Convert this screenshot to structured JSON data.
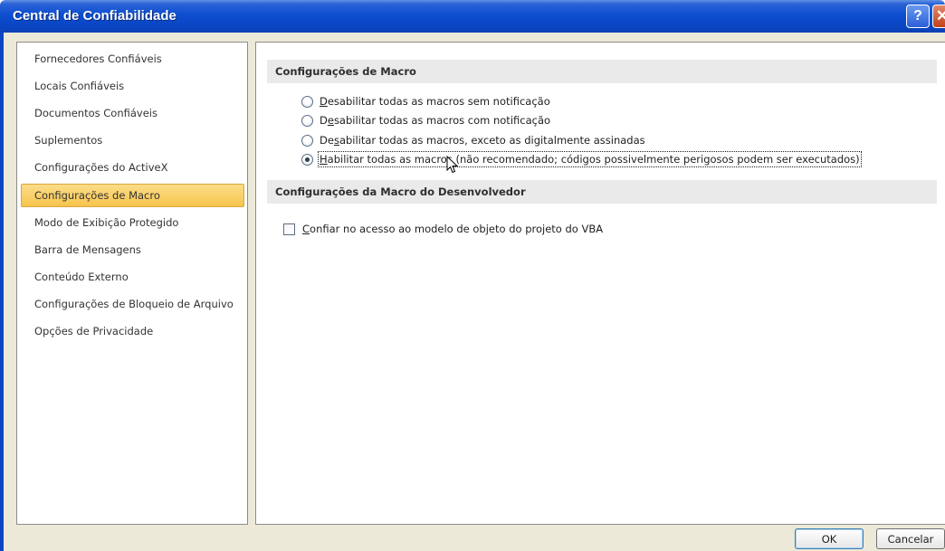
{
  "window": {
    "title": "Central de Confiabilidade",
    "help_icon": "help-icon",
    "help_glyph": "?",
    "close_icon": "close-icon",
    "close_glyph": "✕"
  },
  "sidebar": {
    "selected_index": 5,
    "selected_color": "#f7c54d",
    "items": [
      {
        "label": "Fornecedores Confiáveis"
      },
      {
        "label": "Locais Confiáveis"
      },
      {
        "label": "Documentos Confiáveis"
      },
      {
        "label": "Suplementos"
      },
      {
        "label": "Configurações do ActiveX"
      },
      {
        "label": "Configurações de Macro"
      },
      {
        "label": "Modo de Exibição Protegido"
      },
      {
        "label": "Barra de Mensagens"
      },
      {
        "label": "Conteúdo Externo"
      },
      {
        "label": "Configurações de Bloqueio de Arquivo"
      },
      {
        "label": "Opções de Privacidade"
      }
    ]
  },
  "macro_settings": {
    "header": "Configurações de Macro",
    "options": [
      {
        "accel": "D",
        "rest": "esabilitar todas as macros sem notificação",
        "selected": false
      },
      {
        "pre": "D",
        "accel": "e",
        "rest": "sabilitar todas as macros com notificação",
        "selected": false
      },
      {
        "pre": "De",
        "accel": "s",
        "rest": "abilitar todas as macros, exceto as digitalmente assinadas",
        "selected": false
      },
      {
        "accel": "H",
        "rest": "abilitar todas as macros (não recomendado; códigos possivelmente perigosos podem ser executados)",
        "selected": true
      }
    ]
  },
  "developer_settings": {
    "header": "Configurações da Macro do Desenvolvedor",
    "vba_access": {
      "accel": "C",
      "rest": "onfiar no acesso ao modelo de objeto do projeto do VBA",
      "checked": false
    }
  },
  "mouse_cursor_icon": "arrow-cursor-icon",
  "buttons": {
    "ok": "OK",
    "cancel": "Cancelar"
  }
}
